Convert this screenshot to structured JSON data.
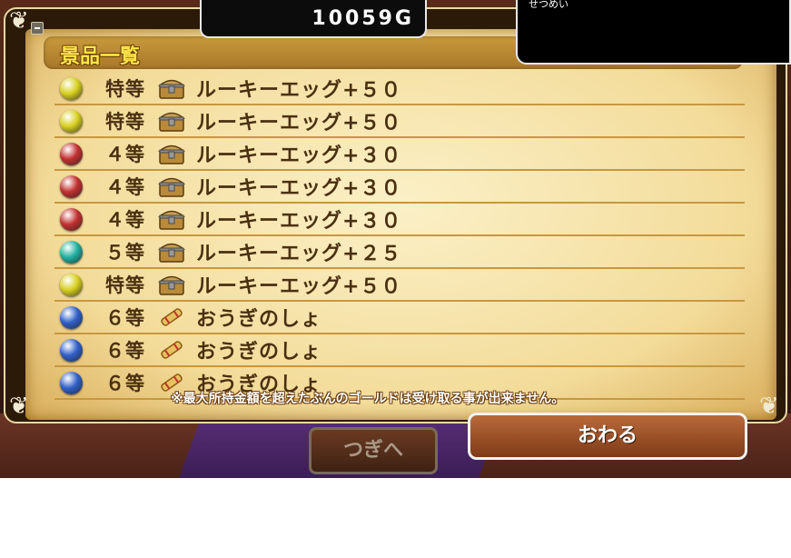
{
  "gold": "10059G",
  "explain": {
    "label": "せつめい"
  },
  "header": {
    "title": "景品一覧"
  },
  "prizes": [
    {
      "rank": "特等",
      "name": "ルーキーエッグ+５０",
      "orb": "yellow",
      "icon": "treasure-chest-icon"
    },
    {
      "rank": "特等",
      "name": "ルーキーエッグ+５０",
      "orb": "yellow",
      "icon": "treasure-chest-icon"
    },
    {
      "rank": "４等",
      "name": "ルーキーエッグ+３０",
      "orb": "red",
      "icon": "treasure-chest-icon"
    },
    {
      "rank": "４等",
      "name": "ルーキーエッグ+３０",
      "orb": "red",
      "icon": "treasure-chest-icon"
    },
    {
      "rank": "４等",
      "name": "ルーキーエッグ+３０",
      "orb": "red",
      "icon": "treasure-chest-icon"
    },
    {
      "rank": "５等",
      "name": "ルーキーエッグ+２５",
      "orb": "teal",
      "icon": "treasure-chest-icon"
    },
    {
      "rank": "特等",
      "name": "ルーキーエッグ+５０",
      "orb": "yellow",
      "icon": "treasure-chest-icon"
    },
    {
      "rank": "６等",
      "name": "おうぎのしょ",
      "orb": "blue",
      "icon": "scroll-icon"
    },
    {
      "rank": "６等",
      "name": "おうぎのしょ",
      "orb": "blue",
      "icon": "scroll-icon"
    },
    {
      "rank": "６等",
      "name": "おうぎのしょ",
      "orb": "blue",
      "icon": "scroll-icon"
    }
  ],
  "note": "※最大所持金額を超えたぶんのゴールドは受け取る事が出来ません。",
  "buttons": {
    "next": "つぎへ",
    "end": "おわる"
  },
  "colors": {
    "yellow": "#d8d020",
    "red": "#c23030",
    "teal": "#20b0a0",
    "blue": "#3060c8"
  }
}
